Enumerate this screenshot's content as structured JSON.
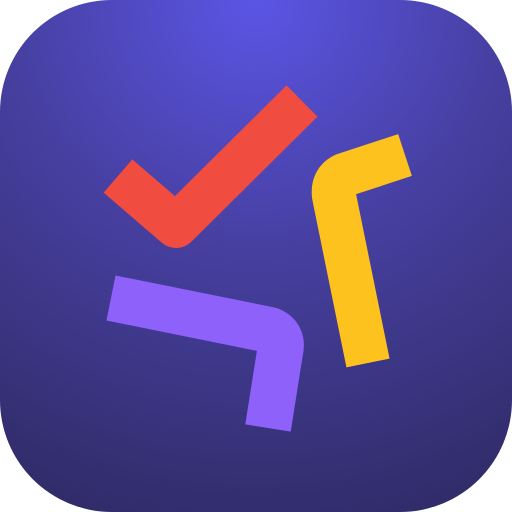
{
  "icon": {
    "name": "app-icon",
    "background": {
      "center": "#5b55e6",
      "mid": "#463f9f",
      "edge": "#2f2a64"
    },
    "marks": {
      "checkmark": "#f04c3f",
      "yellow_bracket": "#fec21f",
      "purple_bracket": "#8f61fb"
    }
  }
}
